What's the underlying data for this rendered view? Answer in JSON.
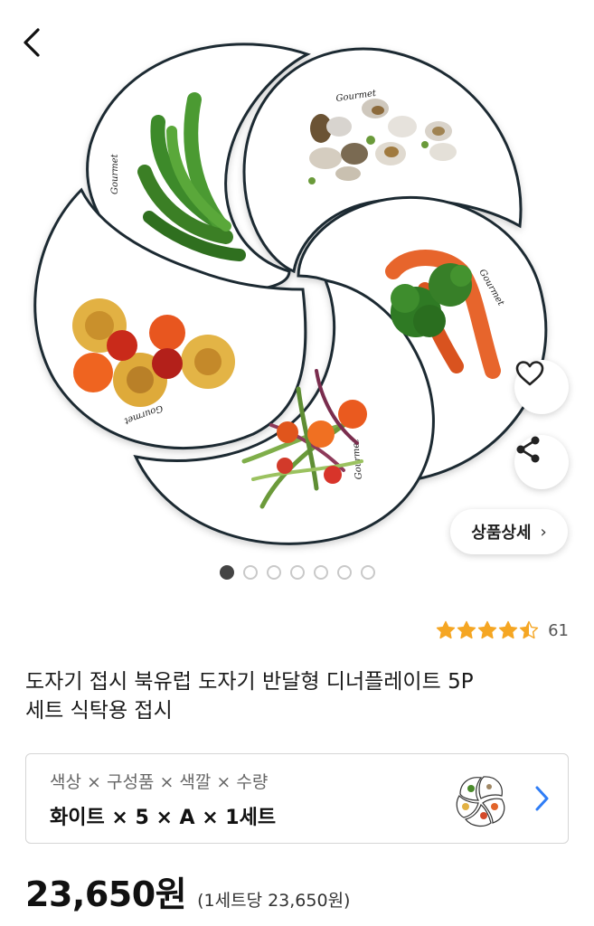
{
  "gallery": {
    "plate_text": "Gourmet",
    "dots_total": 7,
    "dots_active": 1,
    "detail_button_label": "상품상세",
    "detail_button_chevron": "›"
  },
  "icons": {
    "back": "back-arrow-icon",
    "wishlist": "heart-icon",
    "share": "share-icon",
    "option_chevron": "chevron-right-icon"
  },
  "rating": {
    "stars": 4.5,
    "count": "61"
  },
  "product": {
    "title_line1": "도자기 접시 북유럽 도자기 반달형 디너플레이트 5P",
    "title_line2": "세트 식탁용 접시"
  },
  "option": {
    "label": "색상 × 구성품 × 색깔 × 수량",
    "value": "화이트 × 5 × A × 1세트"
  },
  "price": {
    "amount": "23,650원",
    "unit": "(1세트당 23,650원)"
  },
  "colors": {
    "star": "#f5a623",
    "accent_chevron": "#2f7df6",
    "dot_active": "#444444"
  }
}
